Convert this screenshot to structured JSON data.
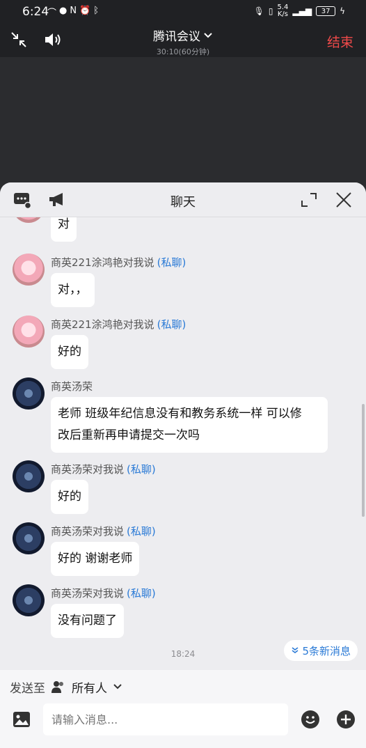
{
  "status_bar": {
    "time": "6:24",
    "net_speed_top": "5.4",
    "net_speed_bottom": "K/s",
    "battery": "37"
  },
  "meeting": {
    "title": "腾讯会议",
    "duration": "30:10(60分钟)",
    "end_label": "结束"
  },
  "chat": {
    "title": "聊天",
    "private_tag": "(私聊)",
    "messages": [
      {
        "sender": "",
        "text": "对",
        "avatar": "pink"
      },
      {
        "sender": "商英221涂鸿艳对我说",
        "text": "对，，",
        "avatar": "pink",
        "private": true
      },
      {
        "sender": "商英221涂鸿艳对我说",
        "text": "好的",
        "avatar": "pink",
        "private": true
      },
      {
        "sender": "商英汤荣",
        "text_line1": "老师 班级年纪信息没有和教务系统一样 可以修",
        "text_line2": "改后重新再申请提交一次吗",
        "avatar": "dark"
      },
      {
        "sender": "商英汤荣对我说",
        "text": "好的",
        "avatar": "dark",
        "private": true
      },
      {
        "sender": "商英汤荣对我说",
        "text": "好的 谢谢老师",
        "avatar": "dark",
        "private": true
      },
      {
        "sender": "商英汤荣对我说",
        "text": "没有问题了",
        "avatar": "dark",
        "private": true
      }
    ],
    "timestamp": "18:24",
    "new_messages": "5条新消息"
  },
  "composer": {
    "send_to_label": "发送至",
    "recipient": "所有人",
    "input_placeholder": "请输入消息..."
  },
  "colors": {
    "accent_blue": "#2a7ad6",
    "end_red": "#f04a4a"
  }
}
